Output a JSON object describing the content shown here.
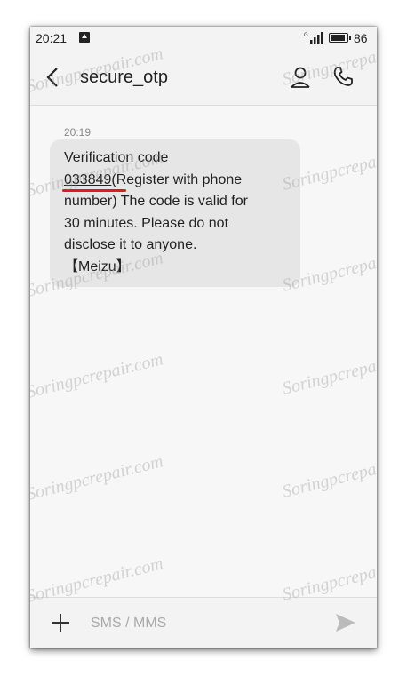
{
  "status_bar": {
    "time": "20:21",
    "notification_icon": "upload-arrow-icon",
    "signal_icon": "signal-icon",
    "battery_icon": "battery-icon",
    "battery_level": "86"
  },
  "app_bar": {
    "back_icon": "chevron-left-icon",
    "title": "secure_otp",
    "contact_icon": "person-icon",
    "call_icon": "phone-icon"
  },
  "thread": {
    "message_time": "20:19",
    "message": {
      "line1": "Verification code",
      "code": "033849",
      "rest": "(Register with phone\nnumber) The code is valid for\n30 minutes. Please do not\ndisclose it to anyone.\n【Meizu】"
    }
  },
  "composer": {
    "add_icon": "plus-icon",
    "placeholder": "SMS / MMS",
    "send_icon": "send-icon"
  },
  "watermark_text": "Soringpcrepair.com",
  "colors": {
    "bubble": "#e6e6e6",
    "bars": "#f3f3f3",
    "highlight": "#e0191e",
    "text": "#222222"
  }
}
